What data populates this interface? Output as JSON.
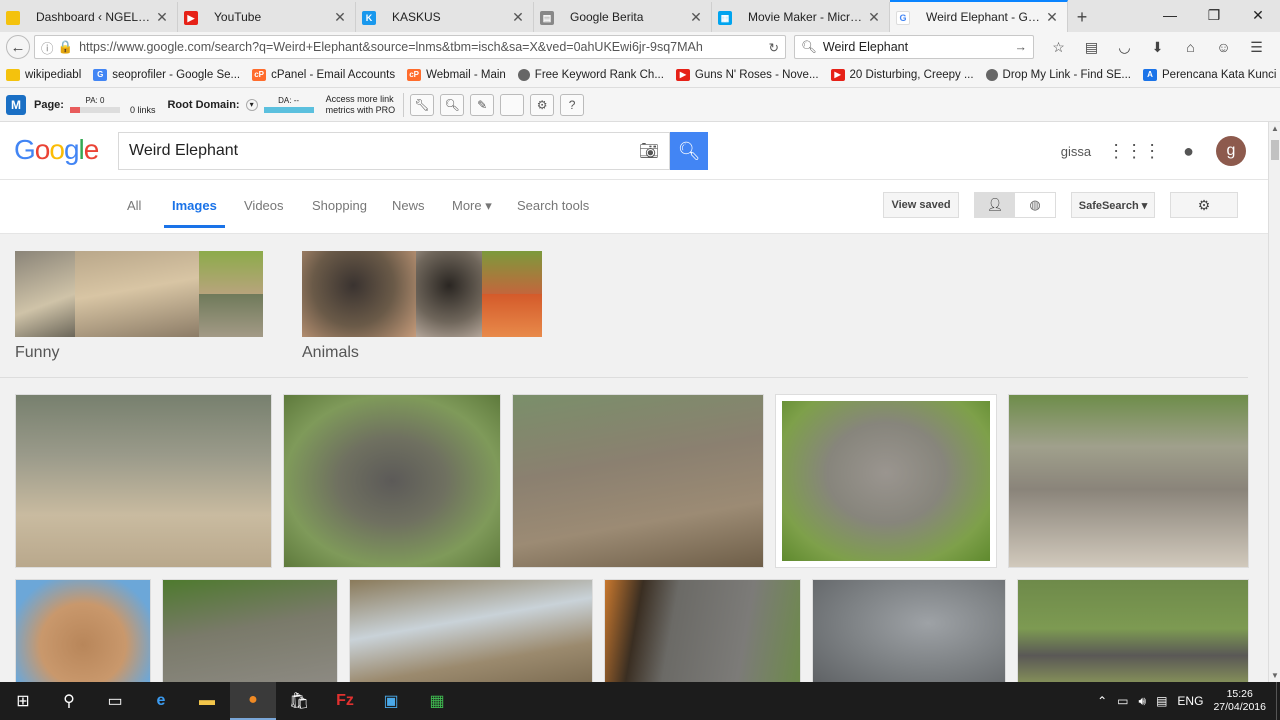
{
  "browser": {
    "tabs": [
      {
        "title": "Dashboard ‹ NGELAG...",
        "fav_color": "#f4c20d"
      },
      {
        "title": "YouTube",
        "fav_color": "#e62117"
      },
      {
        "title": "KASKUS",
        "fav_color": "#1998ed"
      },
      {
        "title": "Google Berita",
        "fav_color": "#888888"
      },
      {
        "title": "Movie Maker - Micros...",
        "fav_color": "#00a4ef"
      },
      {
        "title": "Weird Elephant - Goo...",
        "fav_color": "#4285f4"
      }
    ],
    "url": "https://www.google.com/search?q=Weird+Elephant&source=lnms&tbm=isch&sa=X&ved=0ahUKEwi6jr-9sq7MAh",
    "search_value": "Weird Elephant"
  },
  "bookmarks": [
    {
      "label": "wikipediabl",
      "color": "#f4c20d"
    },
    {
      "label": "seoprofiler - Google Se...",
      "color": "#4285f4"
    },
    {
      "label": "cPanel - Email Accounts",
      "color": "#ff6c2c"
    },
    {
      "label": "Webmail - Main",
      "color": "#ff6c2c"
    },
    {
      "label": "Free Keyword Rank Ch...",
      "color": "#666666"
    },
    {
      "label": "Guns N' Roses - Nove...",
      "color": "#e62117"
    },
    {
      "label": "20 Disturbing, Creepy ...",
      "color": "#e62117"
    },
    {
      "label": "Drop My Link - Find SE...",
      "color": "#666666"
    },
    {
      "label": "Perencana Kata Kunci ...",
      "color": "#1a73e8"
    }
  ],
  "mozbar": {
    "page_label": "Page:",
    "pa_label": "PA: 0",
    "links": "0 links",
    "root_label": "Root Domain:",
    "da_label": "DA: --",
    "pro_line1": "Access more link",
    "pro_line2": "metrics with PRO"
  },
  "google": {
    "logo": "Google",
    "query": "Weird Elephant",
    "user": "gissa",
    "avatar_letter": "g",
    "tabs": [
      "All",
      "Images",
      "Videos",
      "Shopping",
      "News",
      "More ▾",
      "Search tools"
    ],
    "view_saved": "View saved",
    "safesearch": "SafeSearch ▾",
    "collections": [
      "Funny",
      "Animals"
    ]
  },
  "taskbar": {
    "lang": "ENG",
    "time": "15:26",
    "date": "27/04/2016"
  }
}
